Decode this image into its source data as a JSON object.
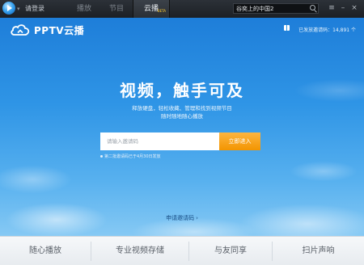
{
  "titlebar": {
    "login_label": "请登录",
    "tabs": [
      {
        "label": "播放",
        "active": false
      },
      {
        "label": "节目",
        "active": false
      },
      {
        "label": "云播",
        "active": true,
        "badge": "BETA"
      }
    ],
    "search_value": "谷奕上的中国2"
  },
  "header": {
    "brand": "PPTV云播",
    "invite_count": "已发放邀请码：14,891 个"
  },
  "hero": {
    "headline": "视频，触手可及",
    "subline1": "释放硬盘，轻松收藏、管理和找到视频节目",
    "subline2": "随时随地随心播放"
  },
  "invite": {
    "placeholder": "请输入邀请码",
    "button_label": "立即进入",
    "note": "第二批邀请码已于4月30日发放",
    "apply_link": "申请邀请码"
  },
  "features": [
    "随心播放",
    "专业视频存储",
    "与友同享",
    "扫片声响"
  ],
  "colors": {
    "sky_top": "#1e7ed9",
    "sky_bottom": "#86c9f4",
    "accent_button": "#f39500"
  }
}
